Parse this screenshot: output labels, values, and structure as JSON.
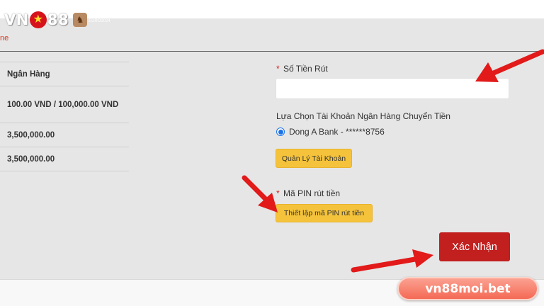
{
  "logo": {
    "prefix": "VN",
    "suffix": "88",
    "small_text": "EURO2024"
  },
  "breadcrumb": "ne",
  "left_table": [
    {
      "text": "Ngân Hàng"
    },
    {
      "text": "100.00 VND / 100,000.00 VND"
    },
    {
      "text": "3,500,000.00"
    },
    {
      "text": "3,500,000.00"
    }
  ],
  "form": {
    "required_mark": "*",
    "amount_label": "Số Tiền Rút",
    "amount_value": "",
    "account_label": "Lựa Chọn Tài Khoản Ngân Hàng Chuyển Tiền",
    "account_option": "Dong A Bank - ******8756",
    "manage_button": "Quản Lý Tài Khoản",
    "pin_label": "Mã PIN rút tiền",
    "pin_button": "Thiết lập mã PIN rút tiền",
    "confirm_button": "Xác Nhận"
  },
  "watermark": "vn88moi.bet",
  "colors": {
    "accent_red": "#c21f1f",
    "button_yellow": "#f5c33b",
    "arrow_red": "#e21a1a",
    "panel_gray": "#e6e6e6"
  }
}
